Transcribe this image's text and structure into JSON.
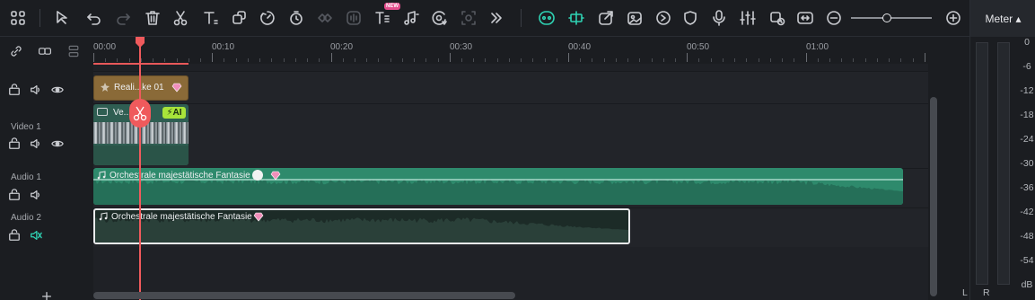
{
  "toolbar": {
    "icons": [
      "layout-icon",
      "select-icon",
      "undo-icon",
      "redo-icon",
      "delete-icon",
      "cut-icon",
      "text-icon",
      "crop-icon",
      "speed-icon",
      "timer-icon",
      "freeze-icon",
      "audio-wave-icon",
      "text-ai-icon",
      "music-icon",
      "ai-color-icon",
      "ai-mask-icon",
      "more-icon",
      "ai-copilot-icon",
      "split-clip-icon",
      "export-icon",
      "image-icon",
      "audio-stretch-icon",
      "shield-icon",
      "mic-icon",
      "mixer-icon",
      "replace-icon",
      "fit-icon",
      "zoom-out-icon",
      "zoom-in-icon"
    ],
    "new_badge": "NEW",
    "zoom_level": 0.38
  },
  "meter": {
    "button_label": "Meter ▴",
    "scale": [
      "0",
      "-6",
      "-12",
      "-18",
      "-24",
      "-30",
      "-36",
      "-42",
      "-48",
      "-54",
      "dB"
    ],
    "left_label": "L",
    "right_label": "R"
  },
  "ruler": {
    "labels": [
      "00:00",
      "00:10",
      "00:20",
      "00:30",
      "00:40",
      "00:50",
      "01:00"
    ]
  },
  "tracks": {
    "video1_label": "Video 1",
    "audio1_label": "Audio 1",
    "audio2_label": "Audio 2"
  },
  "clips": {
    "title_clip": "Reali...ke 01",
    "video_clip": "Ve...",
    "video_ai_badge": "AI",
    "audio1_clip": "Orchestrale majestätische Fantasie",
    "audio2_clip": "Orchestrale majestätische Fantasie"
  },
  "colors": {
    "accent": "#2fd3b4",
    "playhead": "#ef5a5c",
    "audio1": "#2e8a6c",
    "title_clip": "#8a6a38"
  }
}
